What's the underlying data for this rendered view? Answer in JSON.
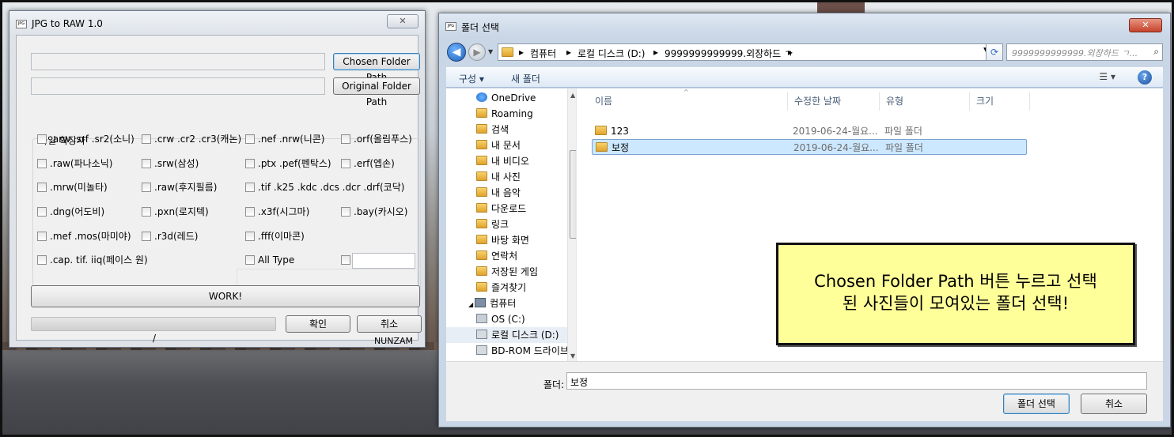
{
  "app": {
    "title": "JPG to RAW 1.0",
    "chosen_button": "Chosen Folder Path",
    "original_button": "Original Folder Path",
    "group_label": "파일 확장자",
    "checkboxes": [
      ".arw .srf .sr2(소니)",
      ".crw .cr2 .cr3(캐논)",
      ".nef .nrw(니콘)",
      ".orf(올림푸스)",
      ".raw(파나소닉)",
      ".srw(삼성)",
      ".ptx .pef(펜탁스)",
      ".erf(엡손)",
      ".mrw(미놀타)",
      ".raw(후지필름)",
      ".tif .k25 .kdc .dcs .dcr .drf(코닥)",
      ".dng(어도비)",
      ".pxn(로지텍)",
      ".x3f(시그마)",
      ".bay(카시오)",
      ".mef .mos(마미야)",
      ".r3d(레드)",
      ".fff(이마콘)",
      ".cap. tif. iiq(페이스 원)",
      "All Type"
    ],
    "work_button": "WORK!",
    "ok_button": "확인",
    "cancel_button": "취소",
    "progress_text": "/",
    "credit": "NUNZAM"
  },
  "dialog": {
    "title": "폴더 선택",
    "breadcrumbs": [
      "컴퓨터",
      "로컬 디스크 (D:)",
      "9999999999999.외장하드 ㄱ"
    ],
    "search_placeholder": "9999999999999.외장하드 ㄱ...",
    "cmd_organize": "구성 ▾",
    "cmd_new_folder": "새 폴더",
    "tree": [
      "OneDrive",
      "Roaming",
      "검색",
      "내 문서",
      "내 비디오",
      "내 사진",
      "내 음악",
      "다운로드",
      "링크",
      "바탕 화면",
      "연락처",
      "저장된 게임",
      "즐겨찾기",
      "컴퓨터",
      "OS (C:)",
      "로컬 디스크 (D:)",
      "BD-ROM 드라이브"
    ],
    "columns": [
      "이름",
      "수정한 날짜",
      "유형",
      "크기"
    ],
    "rows": [
      {
        "name": "123",
        "date": "2019-06-24-월요...",
        "type": "파일 폴더"
      },
      {
        "name": "보정",
        "date": "2019-06-24-월요...",
        "type": "파일 폴더"
      }
    ],
    "folder_label": "폴더:",
    "folder_value": "보정",
    "select_button": "폴더 선택",
    "cancel_button": "취소"
  },
  "callout": {
    "line1": "Chosen Folder Path 버튼 누르고 선택",
    "line2": "된 사진들이 모여있는 폴더 선택!"
  }
}
